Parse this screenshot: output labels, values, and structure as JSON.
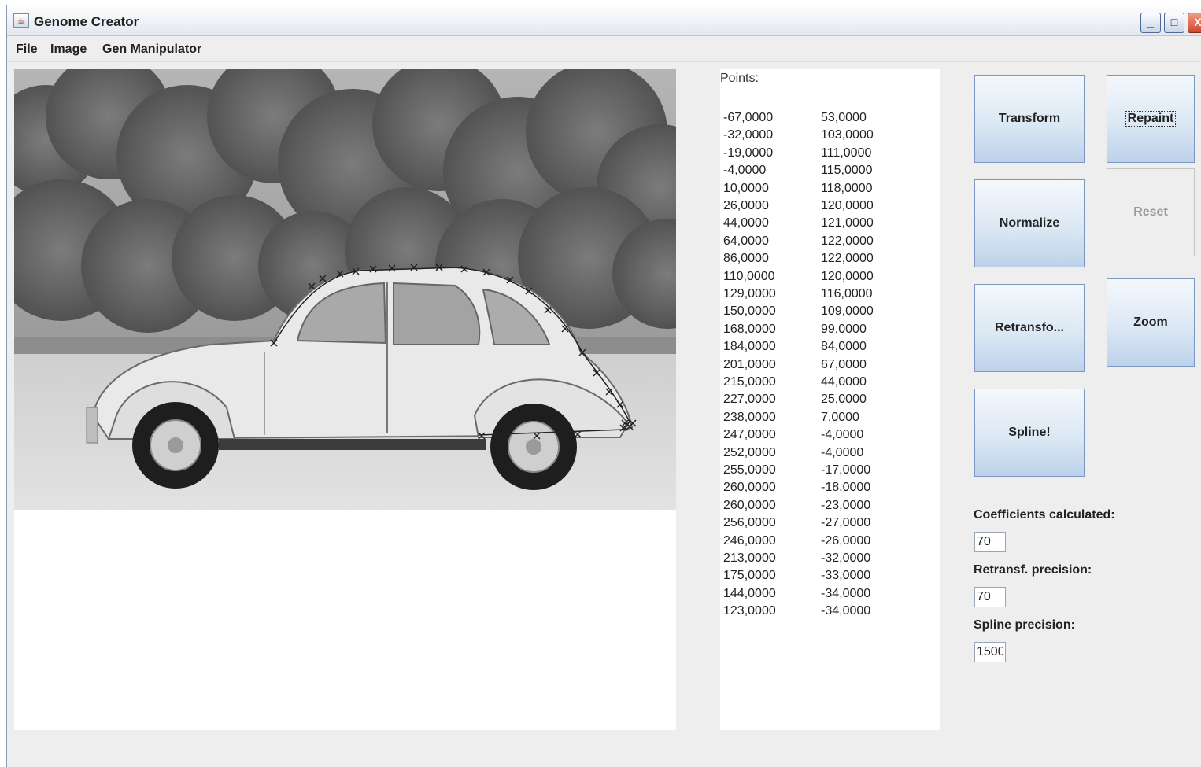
{
  "window": {
    "title": "Genome Creator",
    "controls": {
      "minimize": "_",
      "maximize": "□",
      "close": "X"
    }
  },
  "menu": {
    "items": [
      "File",
      "Image",
      "Gen Manipulator"
    ]
  },
  "canvas": {
    "photo_alt": "Black and white photo of a Citroën 2CV car in a field with trees, contour points marked with crosses",
    "marker_icon": "cross-marker-icon"
  },
  "points": {
    "label": "Points:",
    "rows": [
      [
        "-67,0000",
        "53,0000"
      ],
      [
        "-32,0000",
        "103,0000"
      ],
      [
        "-19,0000",
        "111,0000"
      ],
      [
        "-4,0000",
        "115,0000"
      ],
      [
        "10,0000",
        "118,0000"
      ],
      [
        "26,0000",
        "120,0000"
      ],
      [
        "44,0000",
        "121,0000"
      ],
      [
        "64,0000",
        "122,0000"
      ],
      [
        "86,0000",
        "122,0000"
      ],
      [
        "110,0000",
        "120,0000"
      ],
      [
        "129,0000",
        "116,0000"
      ],
      [
        "150,0000",
        "109,0000"
      ],
      [
        "168,0000",
        "99,0000"
      ],
      [
        "184,0000",
        "84,0000"
      ],
      [
        "201,0000",
        "67,0000"
      ],
      [
        "215,0000",
        "44,0000"
      ],
      [
        "227,0000",
        "25,0000"
      ],
      [
        "238,0000",
        "7,0000"
      ],
      [
        "247,0000",
        "-4,0000"
      ],
      [
        "252,0000",
        "-4,0000"
      ],
      [
        "255,0000",
        "-17,0000"
      ],
      [
        "260,0000",
        "-18,0000"
      ],
      [
        "260,0000",
        "-23,0000"
      ],
      [
        "256,0000",
        "-27,0000"
      ],
      [
        "246,0000",
        "-26,0000"
      ],
      [
        "213,0000",
        "-32,0000"
      ],
      [
        "175,0000",
        "-33,0000"
      ],
      [
        "144,0000",
        "-34,0000"
      ],
      [
        "123,0000",
        "-34,0000"
      ]
    ]
  },
  "buttons": {
    "transform": "Transform",
    "repaint": "Repaint",
    "normalize": "Normalize",
    "reset": "Reset",
    "retransform": "Retransfo...",
    "zoom": "Zoom",
    "spline": "Spline!"
  },
  "fields": {
    "coefficients": {
      "label": "Coefficients calculated:",
      "value": "70"
    },
    "retransf_precision": {
      "label": "Retransf. precision:",
      "value": "70"
    },
    "spline_precision": {
      "label": "Spline precision:",
      "value": "1500"
    }
  },
  "colors": {
    "button_gradient_top": "#f4f8fc",
    "button_gradient_bottom": "#bcd2ea",
    "button_border": "#7a98c2",
    "window_bg": "#eeeeee"
  }
}
